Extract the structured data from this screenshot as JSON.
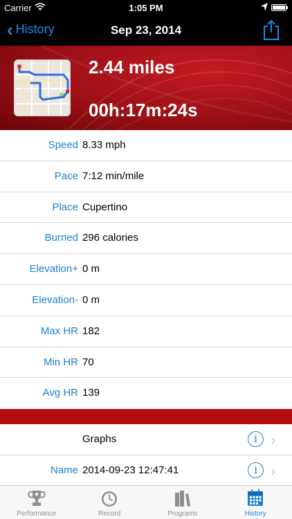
{
  "status": {
    "carrier": "Carrier",
    "time": "1:05 PM",
    "battery_level": 1.0
  },
  "nav": {
    "back_label": "History",
    "title": "Sep 23, 2014"
  },
  "summary": {
    "distance": "2.44 miles",
    "duration": "00h:17m:24s"
  },
  "stats": [
    {
      "label": "Speed",
      "value": "8.33 mph"
    },
    {
      "label": "Pace",
      "value": "7:12 min/mile"
    },
    {
      "label": "Place",
      "value": "Cupertino"
    },
    {
      "label": "Burned",
      "value": "296 calories"
    },
    {
      "label": "Elevation+",
      "value": "0 m"
    },
    {
      "label": "Elevation-",
      "value": "0 m"
    },
    {
      "label": "Max HR",
      "value": "182"
    },
    {
      "label": "Min HR",
      "value": "70"
    },
    {
      "label": "Avg HR",
      "value": "139"
    }
  ],
  "actions": [
    {
      "label": "",
      "value": "Graphs"
    },
    {
      "label": "Name",
      "value": "2014-09-23 12:47:41"
    }
  ],
  "tabs": [
    {
      "label": "Performance",
      "icon": "trophy-icon"
    },
    {
      "label": "Record",
      "icon": "stopwatch-icon"
    },
    {
      "label": "Programs",
      "icon": "books-icon"
    },
    {
      "label": "History",
      "icon": "calendar-icon",
      "active": true
    }
  ],
  "colors": {
    "accent": "#1e7fd0",
    "banner_red": "#b00d13"
  }
}
